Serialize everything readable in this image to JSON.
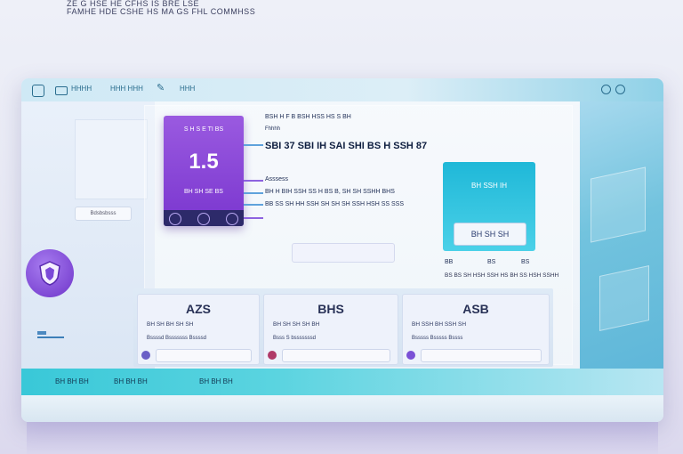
{
  "caption": {
    "line1": "ZE G HSE HE CFHS IS BRE LSE",
    "line2": "FAMHE HDE CSHE HS MA GS FHL COMMHSS"
  },
  "titlebar": {
    "item1": "HHHH",
    "item2": "HHH HHH",
    "item3": "HHH"
  },
  "left": {
    "pill": "Bdsbsbsss"
  },
  "violet_card": {
    "label": "S H S E TI BS",
    "value": "1.5",
    "sub": "BH SH SE BS"
  },
  "info": {
    "row1": "BSH   H   F B BSH  HSS   HS   S   BH",
    "row1b": "Fhhhh",
    "headline": "SBI 37  SBI IH SAI SHI BS H SSH 87",
    "row3": "Asssess",
    "row4": "BH H BIH SSH SS H BS  B, SH SH SSHH BHS",
    "row5": "BB SS SH HH SSH SH SH SH SSH HSH SS SSS"
  },
  "teal_panel": {
    "label": "BH SSH IH",
    "button": "BH SH SH",
    "meta1": "BB",
    "meta2": "BS",
    "meta3": "BS",
    "note": "BS BS SH HSH SSH HS BH SS HSH SSHH"
  },
  "stats": [
    {
      "value": "AZS",
      "label": "BH SH BH SH SH",
      "desc": "Bssssd Bsssssss Bssssd"
    },
    {
      "value": "BHS",
      "label": "BH SH SH SH BH",
      "desc": "Bsss S bsssssssd"
    },
    {
      "value": "ASB",
      "label": "BH SSH BH SSH SH",
      "desc": "Bsssss Bsssss  Bssss"
    }
  ],
  "footer": {
    "tab1": "BH BH BH",
    "tab2": "BH BH BH",
    "tab3": "BH BH BH"
  },
  "colors": {
    "violet": "#7a36cf",
    "teal": "#1fb8d8",
    "navy": "#2d2a6a"
  }
}
